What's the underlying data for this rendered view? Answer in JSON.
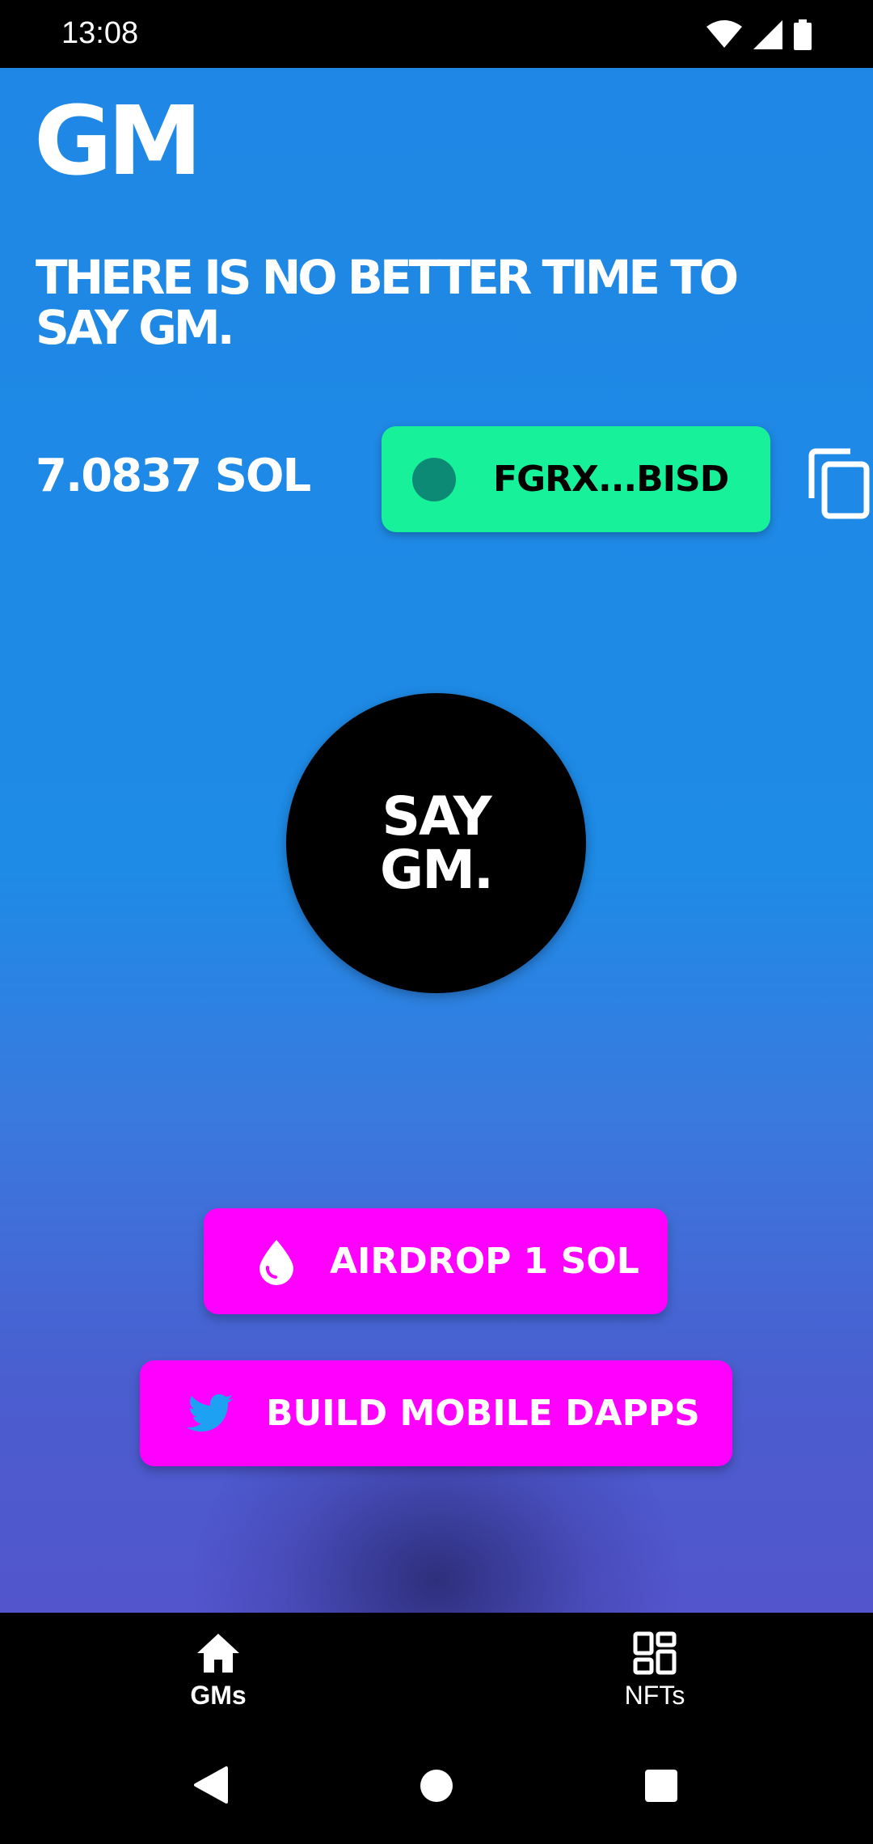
{
  "status_bar": {
    "time": "13:08",
    "icons": [
      "wifi-icon",
      "signal-icon",
      "battery-icon"
    ]
  },
  "header": {
    "logo": "GM",
    "tagline": "THERE IS NO BETTER TIME TO SAY GM."
  },
  "wallet": {
    "balance": "7.0837 SOL",
    "address": "FGRX...BISD",
    "copy_icon": "copy-icon"
  },
  "say_gm": {
    "line1": "SAY",
    "line2": "GM."
  },
  "actions": {
    "airdrop_label": "AIRDROP 1 SOL",
    "airdrop_icon": "water-drop-icon",
    "build_label": "BUILD MOBILE DAPPS",
    "build_icon": "twitter-icon"
  },
  "bottom_nav": {
    "items": [
      {
        "label": "GMs",
        "icon": "home-icon",
        "selected": true
      },
      {
        "label": "NFTs",
        "icon": "grid-icon",
        "selected": false
      }
    ]
  },
  "colors": {
    "background_top": "#1f87e5",
    "background_bottom": "#5355cc",
    "wallet_button": "#17f29a",
    "wallet_dot": "#0d8a76",
    "action_button": "#ff00ff",
    "twitter_blue": "#1da1f2"
  }
}
